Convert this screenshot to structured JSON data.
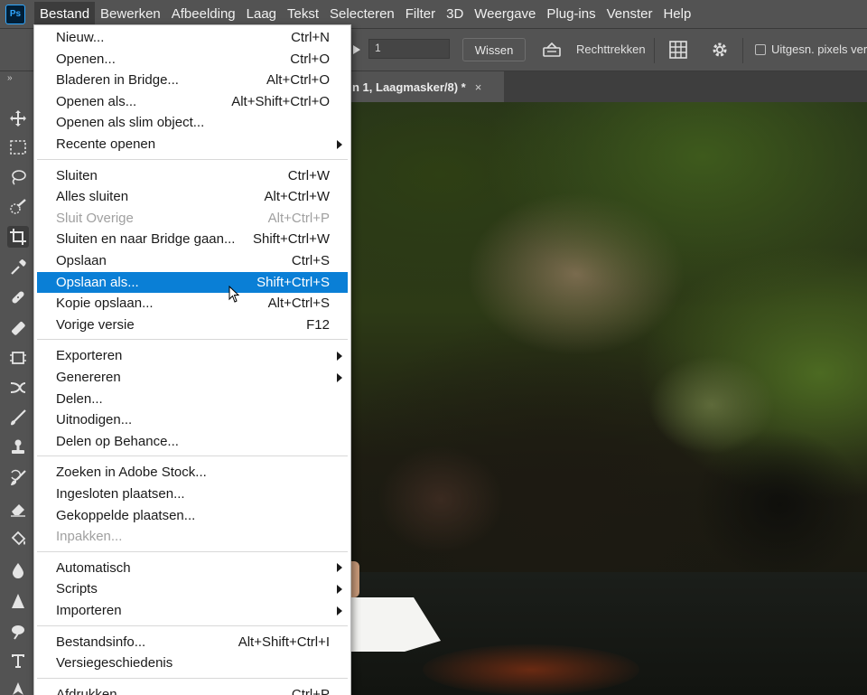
{
  "app": {
    "logo": "Ps"
  },
  "menubar": {
    "items": [
      "Bestand",
      "Bewerken",
      "Afbeelding",
      "Laag",
      "Tekst",
      "Selecteren",
      "Filter",
      "3D",
      "Weergave",
      "Plug-ins",
      "Venster",
      "Help"
    ],
    "active": "Bestand"
  },
  "options": {
    "value_input": "1",
    "clear_button": "Wissen",
    "straighten_label": "Rechttrekken",
    "checkbox_label": "Uitgesn. pixels ver"
  },
  "document_tab": {
    "title": "n 1, Laagmasker/8) *",
    "close": "×"
  },
  "toolbar": {
    "collapse": "»"
  },
  "file_menu": {
    "groups": [
      [
        {
          "label": "Nieuw...",
          "shortcut": "Ctrl+N"
        },
        {
          "label": "Openen...",
          "shortcut": "Ctrl+O"
        },
        {
          "label": "Bladeren in Bridge...",
          "shortcut": "Alt+Ctrl+O"
        },
        {
          "label": "Openen als...",
          "shortcut": "Alt+Shift+Ctrl+O"
        },
        {
          "label": "Openen als slim object...",
          "shortcut": ""
        },
        {
          "label": "Recente openen",
          "shortcut": "",
          "submenu": true
        }
      ],
      [
        {
          "label": "Sluiten",
          "shortcut": "Ctrl+W"
        },
        {
          "label": "Alles sluiten",
          "shortcut": "Alt+Ctrl+W"
        },
        {
          "label": "Sluit Overige",
          "shortcut": "Alt+Ctrl+P",
          "disabled": true
        },
        {
          "label": "Sluiten en naar Bridge gaan...",
          "shortcut": "Shift+Ctrl+W"
        },
        {
          "label": "Opslaan",
          "shortcut": "Ctrl+S"
        },
        {
          "label": "Opslaan als...",
          "shortcut": "Shift+Ctrl+S",
          "highlighted": true
        },
        {
          "label": "Kopie opslaan...",
          "shortcut": "Alt+Ctrl+S"
        },
        {
          "label": "Vorige versie",
          "shortcut": "F12"
        }
      ],
      [
        {
          "label": "Exporteren",
          "shortcut": "",
          "submenu": true
        },
        {
          "label": "Genereren",
          "shortcut": "",
          "submenu": true
        },
        {
          "label": "Delen...",
          "shortcut": ""
        },
        {
          "label": "Uitnodigen...",
          "shortcut": ""
        },
        {
          "label": "Delen op Behance...",
          "shortcut": ""
        }
      ],
      [
        {
          "label": "Zoeken in Adobe Stock...",
          "shortcut": ""
        },
        {
          "label": "Ingesloten plaatsen...",
          "shortcut": ""
        },
        {
          "label": "Gekoppelde plaatsen...",
          "shortcut": ""
        },
        {
          "label": "Inpakken...",
          "shortcut": "",
          "disabled": true
        }
      ],
      [
        {
          "label": "Automatisch",
          "shortcut": "",
          "submenu": true
        },
        {
          "label": "Scripts",
          "shortcut": "",
          "submenu": true
        },
        {
          "label": "Importeren",
          "shortcut": "",
          "submenu": true
        }
      ],
      [
        {
          "label": "Bestandsinfo...",
          "shortcut": "Alt+Shift+Ctrl+I"
        },
        {
          "label": "Versiegeschiedenis",
          "shortcut": ""
        }
      ],
      [
        {
          "label": "Afdrukken...",
          "shortcut": "Ctrl+P"
        }
      ]
    ]
  },
  "colors": {
    "highlight": "#0a7fd6",
    "ui_background": "#535353",
    "ps_accent": "#31a8ff"
  }
}
